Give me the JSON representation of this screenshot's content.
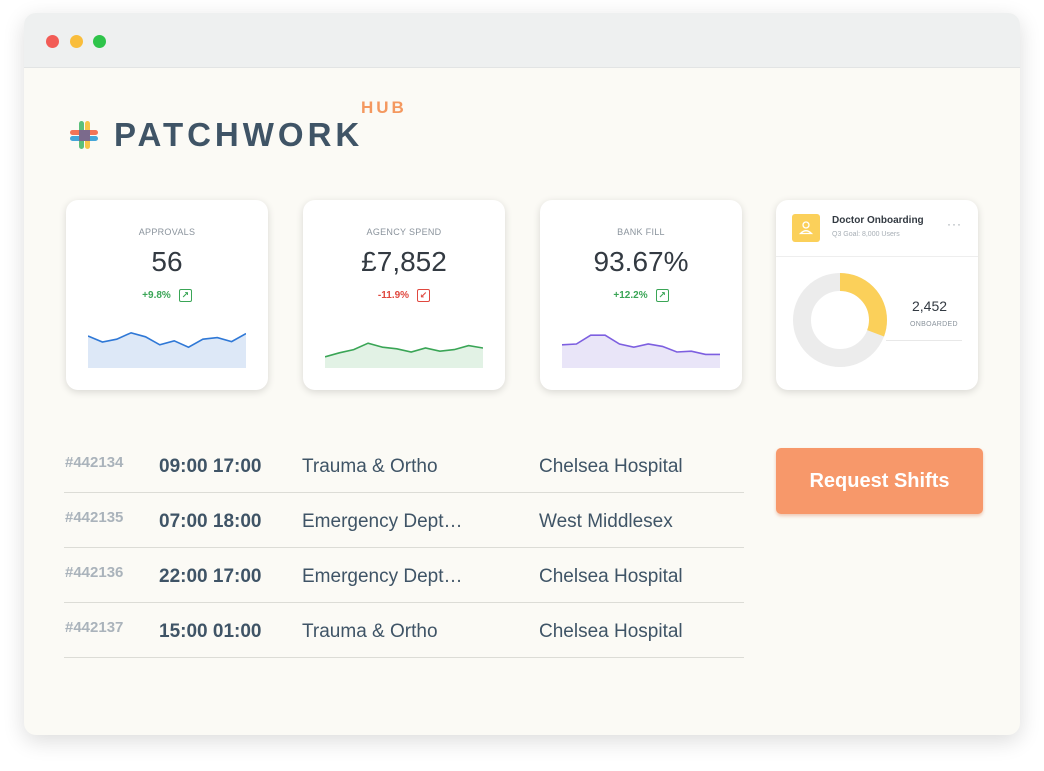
{
  "brand": {
    "name": "PATCHWORK",
    "sub": "HUB"
  },
  "stats": [
    {
      "label": "APPROVALS",
      "value": "56",
      "delta": "+9.8%",
      "trend": "up",
      "color": "#2f78d6",
      "fill": "#dde8f7",
      "spark": [
        0.7,
        0.55,
        0.62,
        0.78,
        0.68,
        0.48,
        0.58,
        0.42,
        0.62,
        0.66,
        0.56,
        0.76
      ]
    },
    {
      "label": "AGENCY SPEND",
      "value": "£7,852",
      "delta": "-11.9%",
      "trend": "down",
      "color": "#3aa556",
      "fill": "#e2f2e5",
      "spark": [
        0.18,
        0.28,
        0.36,
        0.52,
        0.42,
        0.38,
        0.3,
        0.4,
        0.32,
        0.36,
        0.46,
        0.4
      ]
    },
    {
      "label": "BANK FILL",
      "value": "93.67%",
      "delta": "+12.2%",
      "trend": "up",
      "color": "#7d5fe0",
      "fill": "#e9e5f8",
      "spark": [
        0.48,
        0.5,
        0.72,
        0.72,
        0.5,
        0.42,
        0.5,
        0.44,
        0.3,
        0.32,
        0.24,
        0.24
      ]
    }
  ],
  "onboarding": {
    "title": "Doctor Onboarding",
    "subtitle": "Q3 Goal: 8,000 Users",
    "more": "···",
    "count": "2,452",
    "caption": "ONBOARDED",
    "progress": 0.3065,
    "accent": "#fbd05a",
    "track": "#ececec",
    "icon": "user-icon"
  },
  "shifts": [
    {
      "id": "#442134",
      "time": "09:00 17:00",
      "dept": "Trauma & Ortho",
      "hospital": "Chelsea Hospital"
    },
    {
      "id": "#442135",
      "time": "07:00 18:00",
      "dept": "Emergency Dept…",
      "hospital": "West Middlesex"
    },
    {
      "id": "#442136",
      "time": "22:00 17:00",
      "dept": "Emergency Dept…",
      "hospital": "Chelsea Hospital"
    },
    {
      "id": "#442137",
      "time": "15:00 01:00",
      "dept": "Trauma & Ortho",
      "hospital": "Chelsea Hospital"
    }
  ],
  "actions": {
    "request_label": "Request Shifts"
  },
  "colors": {
    "primary_text": "#3f5466",
    "accent_orange": "#f7986a",
    "positive": "#3aa556",
    "negative": "#e0483f"
  }
}
